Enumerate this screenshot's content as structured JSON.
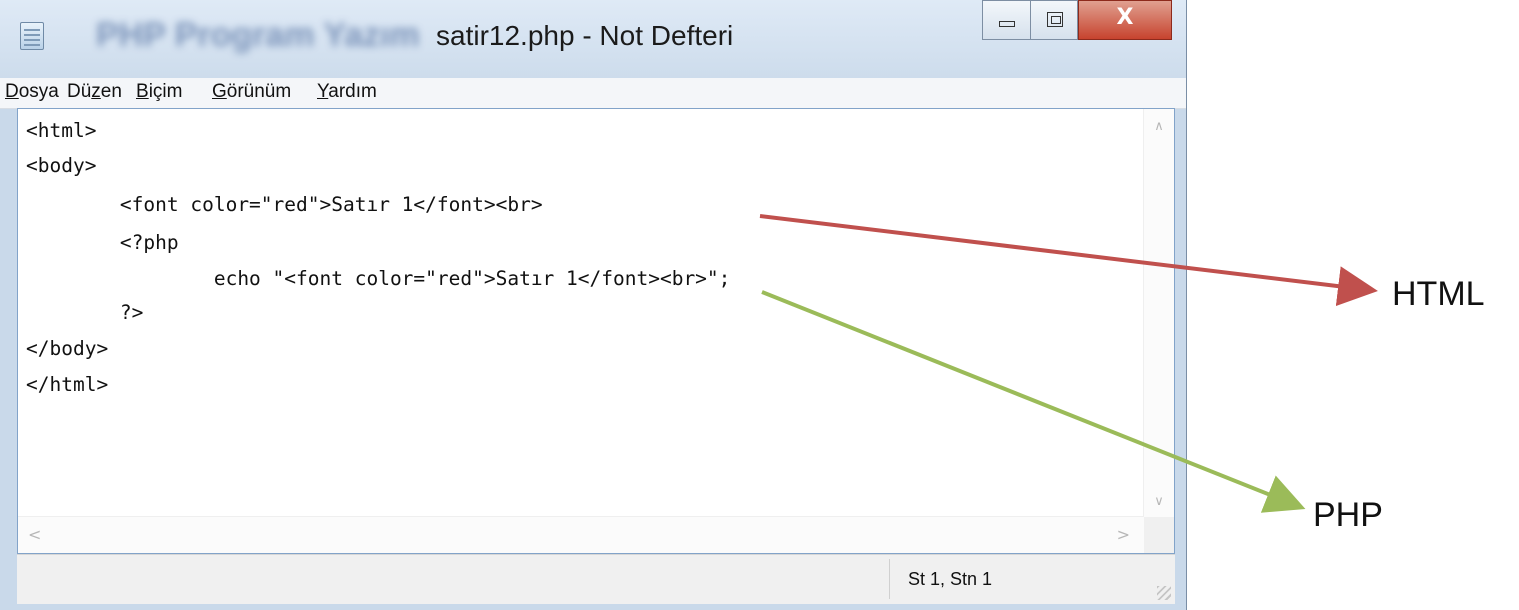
{
  "window": {
    "title": "satir12.php - Not Defteri",
    "blurred_title": "PHP Program Yazım",
    "close_glyph": "X"
  },
  "menu": [
    {
      "accel": "D",
      "rest": "osya"
    },
    {
      "prefix": "Dü",
      "accel": "z",
      "rest": "en"
    },
    {
      "accel": "B",
      "rest": "içim"
    },
    {
      "accel": "G",
      "rest": "örünüm"
    },
    {
      "accel": "Y",
      "rest": "ardım"
    }
  ],
  "code": [
    "<html>",
    "<body>",
    "        <font color=\"red\">Satır 1</font><br>",
    "        <?php",
    "                echo \"<font color=\"red\">Satır 1</font><br>\";",
    "        ?>",
    "</body>",
    "</html>"
  ],
  "status": {
    "position": "St 1, Stn 1"
  },
  "annotations": {
    "html_label": "HTML",
    "php_label": "PHP",
    "html_arrow_color": "#c0504d",
    "php_arrow_color": "#9bbb59"
  }
}
